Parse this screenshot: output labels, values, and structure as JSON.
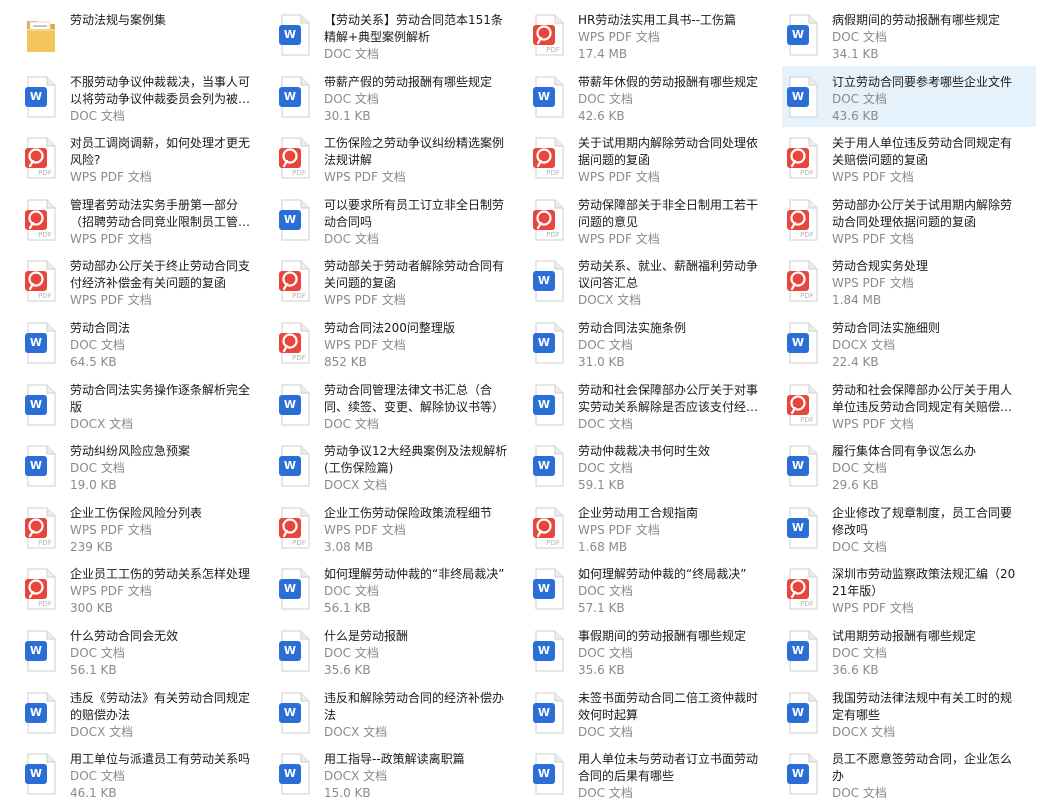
{
  "colors": {
    "doc": "#2b6fd6",
    "pdf": "#e8463c",
    "folder": "#f3c35c",
    "selected": "#e5f1fb"
  },
  "items": [
    {
      "name": "劳动法规与案例集",
      "type": "folder",
      "icon": "folder-icon",
      "size": "",
      "selected": false
    },
    {
      "name": "【劳动关系】劳动合同范本151条精解+典型案例解析",
      "type": "DOC 文档",
      "icon": "word-doc-icon",
      "size": "",
      "selected": false
    },
    {
      "name": "HR劳动法实用工具书--工伤篇",
      "type": "WPS PDF 文档",
      "icon": "pdf-icon",
      "size": "17.4 MB",
      "selected": false
    },
    {
      "name": "病假期间的劳动报酬有哪些规定",
      "type": "DOC 文档",
      "icon": "word-doc-icon",
      "size": "34.1 KB",
      "selected": false
    },
    {
      "name": "不服劳动争议仲裁裁决，当事人可以将劳动争议仲裁委员会列为被…",
      "type": "DOC 文档",
      "icon": "word-doc-icon",
      "size": "",
      "selected": false
    },
    {
      "name": "带薪产假的劳动报酬有哪些规定",
      "type": "DOC 文档",
      "icon": "word-doc-icon",
      "size": "30.1 KB",
      "selected": false
    },
    {
      "name": "带薪年休假的劳动报酬有哪些规定",
      "type": "DOC 文档",
      "icon": "word-doc-icon",
      "size": "42.6 KB",
      "selected": false
    },
    {
      "name": "订立劳动合同要参考哪些企业文件",
      "type": "DOC 文档",
      "icon": "word-doc-icon",
      "size": "43.6 KB",
      "selected": true
    },
    {
      "name": "对员工调岗调薪，如何处理才更无风险?",
      "type": "WPS PDF 文档",
      "icon": "pdf-icon",
      "size": "",
      "selected": false
    },
    {
      "name": "工伤保险之劳动争议纠纷精选案例法规讲解",
      "type": "WPS PDF 文档",
      "icon": "pdf-icon",
      "size": "",
      "selected": false
    },
    {
      "name": "关于试用期内解除劳动合同处理依据问题的复函",
      "type": "WPS PDF 文档",
      "icon": "pdf-icon",
      "size": "",
      "selected": false
    },
    {
      "name": "关于用人单位违反劳动合同规定有关赔偿问题的复函",
      "type": "WPS PDF 文档",
      "icon": "pdf-icon",
      "size": "",
      "selected": false
    },
    {
      "name": "管理者劳动法实务手册第一部分（招聘劳动合同竞业限制员工管理…",
      "type": "WPS PDF 文档",
      "icon": "pdf-icon",
      "size": "",
      "selected": false
    },
    {
      "name": "可以要求所有员工订立非全日制劳动合同吗",
      "type": "DOC 文档",
      "icon": "word-doc-icon",
      "size": "",
      "selected": false
    },
    {
      "name": "劳动保障部关于非全日制用工若干问题的意见",
      "type": "WPS PDF 文档",
      "icon": "pdf-icon",
      "size": "",
      "selected": false
    },
    {
      "name": "劳动部办公厅关于试用期内解除劳动合同处理依据问题的复函",
      "type": "WPS PDF 文档",
      "icon": "pdf-icon",
      "size": "",
      "selected": false
    },
    {
      "name": "劳动部办公厅关于终止劳动合同支付经济补偿金有关问题的复函",
      "type": "WPS PDF 文档",
      "icon": "pdf-icon",
      "size": "",
      "selected": false
    },
    {
      "name": "劳动部关于劳动者解除劳动合同有关问题的复函",
      "type": "WPS PDF 文档",
      "icon": "pdf-icon",
      "size": "",
      "selected": false
    },
    {
      "name": "劳动关系、就业、薪酬福利劳动争议问答汇总",
      "type": "DOCX 文档",
      "icon": "word-docx-icon",
      "size": "",
      "selected": false
    },
    {
      "name": "劳动合规实务处理",
      "type": "WPS PDF 文档",
      "icon": "pdf-icon",
      "size": "1.84 MB",
      "selected": false
    },
    {
      "name": "劳动合同法",
      "type": "DOC 文档",
      "icon": "word-doc-icon",
      "size": "64.5 KB",
      "selected": false
    },
    {
      "name": "劳动合同法200问整理版",
      "type": "WPS PDF 文档",
      "icon": "pdf-icon",
      "size": "852 KB",
      "selected": false
    },
    {
      "name": "劳动合同法实施条例",
      "type": "DOC 文档",
      "icon": "word-doc-icon",
      "size": "31.0 KB",
      "selected": false
    },
    {
      "name": "劳动合同法实施细则",
      "type": "DOCX 文档",
      "icon": "word-docx-icon",
      "size": "22.4 KB",
      "selected": false
    },
    {
      "name": "劳动合同法实务操作逐条解析完全版",
      "type": "DOCX 文档",
      "icon": "word-docx-icon",
      "size": "",
      "selected": false
    },
    {
      "name": "劳动合同管理法律文书汇总（合同、续签、变更、解除协议书等）",
      "type": "DOC 文档",
      "icon": "word-doc-icon",
      "size": "",
      "selected": false
    },
    {
      "name": "劳动和社会保障部办公厅关于对事实劳动关系解除是否应该支付经济…",
      "type": "DOC 文档",
      "icon": "word-doc-icon",
      "size": "",
      "selected": false
    },
    {
      "name": "劳动和社会保障部办公厅关于用人单位违反劳动合同规定有关赔偿…",
      "type": "WPS PDF 文档",
      "icon": "pdf-icon",
      "size": "",
      "selected": false
    },
    {
      "name": "劳动纠纷风险应急预案",
      "type": "DOC 文档",
      "icon": "word-doc-icon",
      "size": "19.0 KB",
      "selected": false
    },
    {
      "name": "劳动争议12大经典案例及法规解析(工伤保险篇)",
      "type": "DOCX 文档",
      "icon": "word-docx-icon",
      "size": "",
      "selected": false
    },
    {
      "name": "劳动仲裁裁决书何时生效",
      "type": "DOC 文档",
      "icon": "word-doc-icon",
      "size": "59.1 KB",
      "selected": false
    },
    {
      "name": "履行集体合同有争议怎么办",
      "type": "DOC 文档",
      "icon": "word-doc-icon",
      "size": "29.6 KB",
      "selected": false
    },
    {
      "name": "企业工伤保险风险分列表",
      "type": "WPS PDF 文档",
      "icon": "pdf-icon",
      "size": "239 KB",
      "selected": false
    },
    {
      "name": "企业工伤劳动保险政策流程细节",
      "type": "WPS PDF 文档",
      "icon": "pdf-icon",
      "size": "3.08 MB",
      "selected": false
    },
    {
      "name": "企业劳动用工合规指南",
      "type": "WPS PDF 文档",
      "icon": "pdf-icon",
      "size": "1.68 MB",
      "selected": false
    },
    {
      "name": "企业修改了规章制度，员工合同要修改吗",
      "type": "DOC 文档",
      "icon": "word-doc-icon",
      "size": "",
      "selected": false
    },
    {
      "name": "企业员工工伤的劳动关系怎样处理",
      "type": "WPS PDF 文档",
      "icon": "pdf-icon",
      "size": "300 KB",
      "selected": false
    },
    {
      "name": "如何理解劳动仲裁的“非终局裁决”",
      "type": "DOC 文档",
      "icon": "word-doc-icon",
      "size": "56.1 KB",
      "selected": false
    },
    {
      "name": "如何理解劳动仲裁的“终局裁决”",
      "type": "DOC 文档",
      "icon": "word-doc-icon",
      "size": "57.1 KB",
      "selected": false
    },
    {
      "name": "深圳市劳动监察政策法规汇编（2021年版）",
      "type": "WPS PDF 文档",
      "icon": "pdf-icon",
      "size": "",
      "selected": false
    },
    {
      "name": "什么劳动合同会无效",
      "type": "DOC 文档",
      "icon": "word-doc-icon",
      "size": "56.1 KB",
      "selected": false
    },
    {
      "name": "什么是劳动报酬",
      "type": "DOC 文档",
      "icon": "word-doc-icon",
      "size": "35.6 KB",
      "selected": false
    },
    {
      "name": "事假期间的劳动报酬有哪些规定",
      "type": "DOC 文档",
      "icon": "word-doc-icon",
      "size": "35.6 KB",
      "selected": false
    },
    {
      "name": "试用期劳动报酬有哪些规定",
      "type": "DOC 文档",
      "icon": "word-doc-icon",
      "size": "36.6 KB",
      "selected": false
    },
    {
      "name": "违反《劳动法》有关劳动合同规定的赔偿办法",
      "type": "DOCX 文档",
      "icon": "word-docx-icon",
      "size": "",
      "selected": false
    },
    {
      "name": "违反和解除劳动合同的经济补偿办法",
      "type": "DOCX 文档",
      "icon": "word-docx-icon",
      "size": "",
      "selected": false
    },
    {
      "name": "未签书面劳动合同二倍工资仲裁时效何时起算",
      "type": "DOC 文档",
      "icon": "word-doc-icon",
      "size": "",
      "selected": false
    },
    {
      "name": "我国劳动法律法规中有关工时的规定有哪些",
      "type": "DOCX 文档",
      "icon": "word-docx-icon",
      "size": "",
      "selected": false
    },
    {
      "name": "用工单位与派遣员工有劳动关系吗",
      "type": "DOC 文档",
      "icon": "word-doc-icon",
      "size": "46.1 KB",
      "selected": false
    },
    {
      "name": "用工指导--政策解读离职篇",
      "type": "DOCX 文档",
      "icon": "word-docx-icon",
      "size": "15.0 KB",
      "selected": false
    },
    {
      "name": "用人单位未与劳动者订立书面劳动合同的后果有哪些",
      "type": "DOC 文档",
      "icon": "word-doc-icon",
      "size": "",
      "selected": false
    },
    {
      "name": "员工不愿意签劳动合同，企业怎么办",
      "type": "DOC 文档",
      "icon": "word-doc-icon",
      "size": "",
      "selected": false
    }
  ]
}
